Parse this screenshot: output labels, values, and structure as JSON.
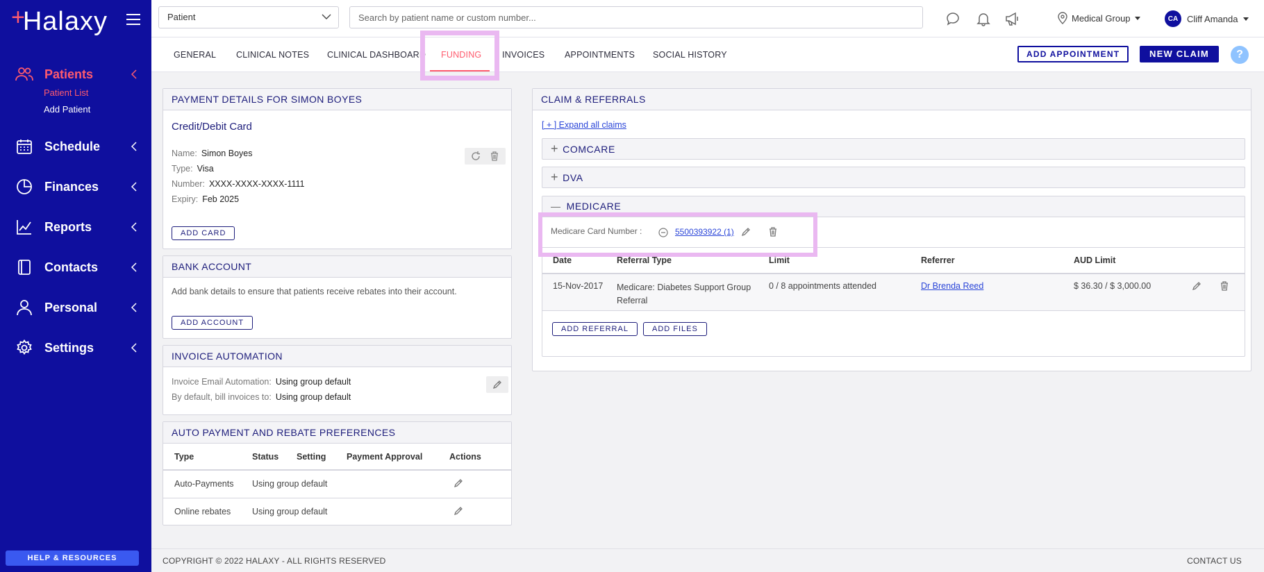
{
  "brand": {
    "name": "Halaxy"
  },
  "sidebar": {
    "items": [
      {
        "label": "Patients",
        "icon": "users-icon"
      },
      {
        "label": "Schedule",
        "icon": "calendar-icon"
      },
      {
        "label": "Finances",
        "icon": "pie-chart-icon"
      },
      {
        "label": "Reports",
        "icon": "line-chart-icon"
      },
      {
        "label": "Contacts",
        "icon": "book-icon"
      },
      {
        "label": "Personal",
        "icon": "person-icon"
      },
      {
        "label": "Settings",
        "icon": "gear-icon"
      }
    ],
    "sub": {
      "patient_list": "Patient List",
      "add_patient": "Add Patient"
    },
    "help": "HELP & RESOURCES"
  },
  "topbar": {
    "select_value": "Patient",
    "search_placeholder": "Search by patient name or custom number...",
    "location": "Medical Group",
    "user_initials": "CA",
    "user_name": "Cliff Amanda"
  },
  "tabs": [
    "GENERAL",
    "CLINICAL NOTES",
    "CLINICAL DASHBOARD",
    "FUNDING",
    "INVOICES",
    "APPOINTMENTS",
    "SOCIAL HISTORY"
  ],
  "actions": {
    "add_appointment": "ADD APPOINTMENT",
    "new_claim": "NEW CLAIM",
    "help": "?"
  },
  "payment": {
    "title": "PAYMENT DETAILS FOR SIMON BOYES",
    "card_type_title": "Credit/Debit Card",
    "name_label": "Name:",
    "name": "Simon Boyes",
    "type_label": "Type:",
    "type": "Visa",
    "number_label": "Number:",
    "number": "XXXX-XXXX-XXXX-1111",
    "expiry_label": "Expiry:",
    "expiry": "Feb 2025",
    "add_card": "ADD CARD"
  },
  "bank": {
    "title": "BANK ACCOUNT",
    "text": "Add bank details to ensure that patients receive rebates into their account.",
    "add_account": "ADD ACCOUNT"
  },
  "invoice_auto": {
    "title": "INVOICE AUTOMATION",
    "email_label": "Invoice Email Automation:",
    "email_value": "Using group default",
    "bill_label": "By default, bill invoices to:",
    "bill_value": "Using group default"
  },
  "auto_pay": {
    "title": "AUTO PAYMENT AND REBATE PREFERENCES",
    "headers": [
      "Type",
      "Status",
      "Setting",
      "Payment Approval",
      "Actions"
    ],
    "rows": [
      {
        "type": "Auto-Payments",
        "status": "Using group default"
      },
      {
        "type": "Online rebates",
        "status": "Using group default"
      }
    ]
  },
  "claims": {
    "title": "CLAIM & REFERRALS",
    "expand_all": "[ + ] Expand all claims",
    "groups": [
      {
        "name": "COMCARE",
        "sign": "+"
      },
      {
        "name": "DVA",
        "sign": "+"
      },
      {
        "name": "MEDICARE",
        "sign": "—"
      }
    ],
    "medicare": {
      "card_label": "Medicare Card Number :",
      "card_number": "5500393922 (1)",
      "headers": [
        "Date",
        "Referral Type",
        "Limit",
        "Referrer",
        "AUD Limit"
      ],
      "row": {
        "date": "15-Nov-2017",
        "referral_type_1": "Medicare: Diabetes Support Group",
        "referral_type_2": "Referral",
        "limit": "0 / 8 appointments attended",
        "referrer": "Dr Brenda Reed",
        "aud_limit": "$ 36.30 / $ 3,000.00"
      },
      "add_referral": "ADD REFERRAL",
      "add_files": "ADD FILES"
    }
  },
  "footer": {
    "copyright": "COPYRIGHT © 2022 HALAXY - ALL RIGHTS RESERVED",
    "contact": "CONTACT US"
  },
  "colors": {
    "sidebar": "#0f0f9e",
    "accent": "#ff5b6e",
    "highlight": "#eab8f1",
    "link": "#2a45d8"
  }
}
